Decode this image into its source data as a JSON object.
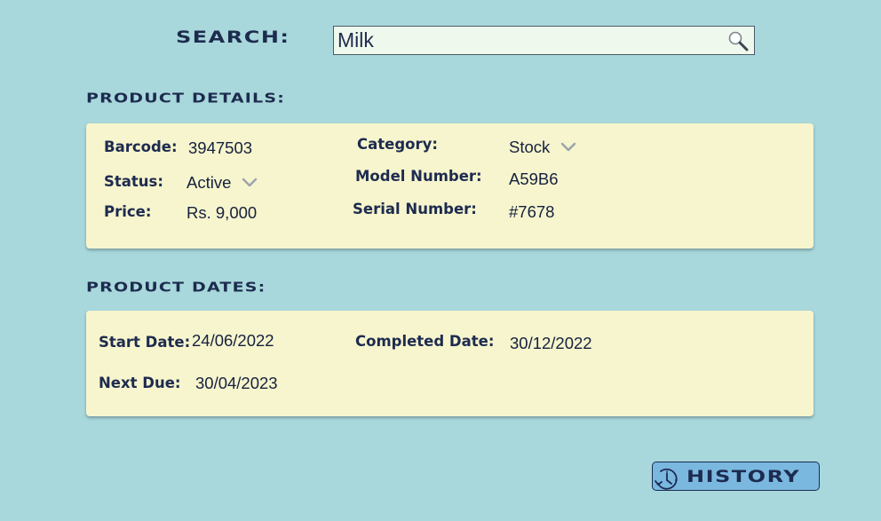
{
  "search": {
    "label": "SEARCH:",
    "value": "Milk"
  },
  "product_details": {
    "title": "PRODUCT DETAILS:",
    "barcode_label": "Barcode:",
    "barcode_value": "3947503",
    "status_label": "Status:",
    "status_value": "Active",
    "price_label": "Price:",
    "price_value": "Rs. 9,000",
    "category_label": "Category:",
    "category_value": "Stock",
    "model_label": "Model Number:",
    "model_value": "A59B6",
    "serial_label": "Serial Number:",
    "serial_value": "#7678"
  },
  "product_dates": {
    "title": "PRODUCT DATES:",
    "start_label": "Start Date:",
    "start_value": "24/06/2022",
    "completed_label": "Completed Date:",
    "completed_value": "30/12/2022",
    "next_due_label": "Next Due:",
    "next_due_value": "30/04/2023"
  },
  "history_button": {
    "label": "HISTORY",
    "icon": "clock-history-icon"
  },
  "colors": {
    "background": "#a8d8db",
    "card": "#f7f5cd",
    "text": "#1d2b4f",
    "search_box": "#eff8ec",
    "history_button": "#7ab8e0"
  }
}
